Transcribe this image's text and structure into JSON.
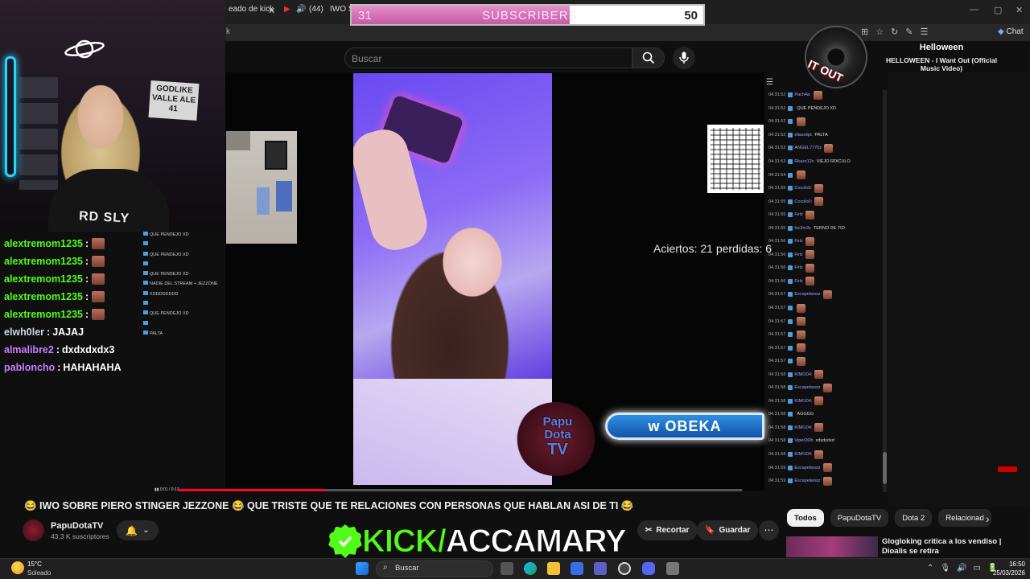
{
  "browser": {
    "tab1_label": "eado de kick",
    "tab2_count": "(44)",
    "tab2_label": "IWO S",
    "address_fragment": "k",
    "chat_button": "Chat"
  },
  "subscribers": {
    "current": "31",
    "label": "SUBSCRIBERS",
    "goal": "50",
    "progress": 0.62
  },
  "youtube": {
    "search_placeholder": "Buscar"
  },
  "video": {
    "score_text": "Aciertos: 21 perdidas: 6",
    "logo_text_1": "Papu",
    "logo_text_2": "Dota",
    "logo_text_3": "TV",
    "banner_text": "w OBEKA",
    "progress": 0.26
  },
  "webcam": {
    "wall_sign": "GODLIKE VALLE ALE 41",
    "shirt_text": "RD SLY"
  },
  "overlay_chat": [
    {
      "user": "alextremom1235",
      "color": "#53fc18",
      "msg": "",
      "emote": true
    },
    {
      "user": "alextremom1235",
      "color": "#53fc18",
      "msg": "",
      "emote": true
    },
    {
      "user": "alextremom1235",
      "color": "#53fc18",
      "msg": "",
      "emote": true
    },
    {
      "user": "alextremom1235",
      "color": "#53fc18",
      "msg": "",
      "emote": true
    },
    {
      "user": "alextremom1235",
      "color": "#53fc18",
      "msg": "",
      "emote": true
    },
    {
      "user": "elwh0ler",
      "color": "#cfd6e0",
      "msg": "JAJAJ",
      "emote": false
    },
    {
      "user": "almalibre2",
      "color": "#c77dff",
      "msg": "dxdxdxdx3",
      "emote": false
    },
    {
      "user": "pabloncho",
      "color": "#c77dff",
      "msg": "HAHAHAHA",
      "emote": false
    }
  ],
  "mini_chat": [
    "QUE PENDEJO XD",
    "",
    "QUE PENDEJO XD",
    "",
    "QUE PENDEJO XD",
    "NADIE DEL STREAM + JEZZONE",
    "XDDDDDDDD",
    "",
    "QUE PENDEJO XD",
    "",
    "PALTA"
  ],
  "live_chat": [
    {
      "time": "04:31:52",
      "name": "Pach4a:",
      "msg": ""
    },
    {
      "time": "04:31:52",
      "name": "",
      "msg": "QUE PENDEJO XD"
    },
    {
      "time": "04:31:52",
      "name": "",
      "msg": ""
    },
    {
      "time": "04:31:52",
      "name": "eliasrdpc",
      "msg": "PALTA"
    },
    {
      "time": "04:31:53",
      "name": "ANGEL7770z",
      "msg": ""
    },
    {
      "time": "04:31:53",
      "name": "Rkazz12s",
      "msg": "VIEJO RDICULO"
    },
    {
      "time": "04:31:54",
      "name": "",
      "msg": ""
    },
    {
      "time": "04:31:55",
      "name": "Cocolo0:",
      "msg": ""
    },
    {
      "time": "04:31:55",
      "name": "Cocolo0:",
      "msg": ""
    },
    {
      "time": "04:31:55",
      "name": "Firlz",
      "msg": ""
    },
    {
      "time": "04:31:55",
      "name": "Isc2m3s",
      "msg": "TERNO DE TIO"
    },
    {
      "time": "04:31:56",
      "name": "Firlz",
      "msg": ""
    },
    {
      "time": "04:31:56",
      "name": "Firlz",
      "msg": ""
    },
    {
      "time": "04:31:56",
      "name": "Firlz",
      "msg": ""
    },
    {
      "time": "04:31:56",
      "name": "Firlz",
      "msg": ""
    },
    {
      "time": "04:31:57",
      "name": "Escapelwosz",
      "msg": ""
    },
    {
      "time": "04:31:57",
      "name": "",
      "msg": ""
    },
    {
      "time": "04:31:57",
      "name": "",
      "msg": ""
    },
    {
      "time": "04:31:57",
      "name": "",
      "msg": ""
    },
    {
      "time": "04:31:57",
      "name": "",
      "msg": ""
    },
    {
      "time": "04:31:57",
      "name": "",
      "msg": ""
    },
    {
      "time": "04:31:58",
      "name": "KIMI104:",
      "msg": ""
    },
    {
      "time": "04:31:58",
      "name": "Escapelwosz",
      "msg": ""
    },
    {
      "time": "04:31:58",
      "name": "KIMI104:",
      "msg": ""
    },
    {
      "time": "04:31:58",
      "name": "",
      "msg": "AGGGG"
    },
    {
      "time": "04:31:58",
      "name": "KIMI104:",
      "msg": ""
    },
    {
      "time": "04:31:58",
      "name": "Viper26lh",
      "msg": "xdxdxdxd"
    },
    {
      "time": "04:31:58",
      "name": "KIMI104:",
      "msg": ""
    },
    {
      "time": "04:31:59",
      "name": "Escapelwosz",
      "msg": ""
    },
    {
      "time": "04:31:59",
      "name": "Escapelwosz",
      "msg": ""
    }
  ],
  "now_playing": {
    "disc_text": "IT OUT",
    "title": "Helloween",
    "subtitle": "HELLOWEEN - I Want Out (Official Music Video)"
  },
  "video_info": {
    "title": "😂 IWO SOBRE PIERO STINGER JEZZONE 😂 QUE TRISTE QUE TE RELACIONES CON PERSONAS QUE HABLAN ASI DE TI 😂",
    "channel": "PapuDotaTV",
    "subs": "43,3 K suscriptores",
    "clip_label": "Recortar",
    "save_label": "Guardar",
    "more_label": "⋯"
  },
  "kick_overlay": {
    "part1": "KICK/",
    "part2": "ACCAMARY"
  },
  "chips": [
    "Todos",
    "PapuDotaTV",
    "Dota 2",
    "Relacionad"
  ],
  "recommended": {
    "title": "Glogloking critica a los vendiso | Dioalis se retira"
  },
  "taskbar": {
    "temp": "15°C",
    "weather": "Soleado",
    "search_placeholder": "Buscar",
    "time": "16:50",
    "date": "25/03/2026"
  }
}
